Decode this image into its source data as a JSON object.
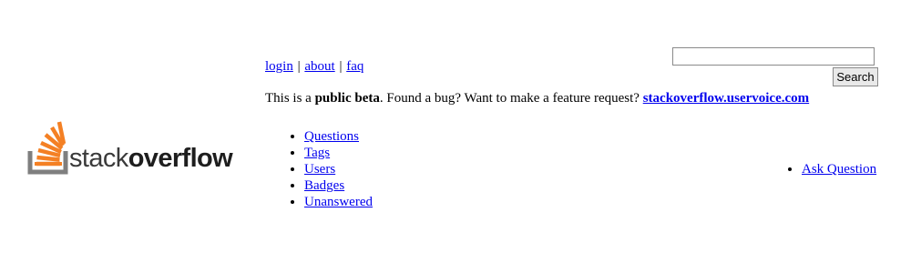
{
  "logo": {
    "text_light": "stack",
    "text_bold": "overflow",
    "colors": {
      "stripes": "#f48024",
      "tray": "#7f7f7f"
    }
  },
  "toplinks": {
    "items": [
      "login",
      "about",
      "faq"
    ],
    "separator": "|"
  },
  "search": {
    "value": "",
    "button_label": "Search"
  },
  "beta_notice": {
    "prefix": "This is a ",
    "emphasis": "public beta",
    "middle": ". Found a bug? Want to make a feature request? ",
    "link": "stackoverflow.uservoice.com"
  },
  "nav": {
    "items": [
      "Questions",
      "Tags",
      "Users",
      "Badges",
      "Unanswered"
    ]
  },
  "ask": {
    "label": "Ask Question"
  },
  "colors": {
    "link": "#0000ee",
    "text": "#000000",
    "background": "#ffffff"
  }
}
